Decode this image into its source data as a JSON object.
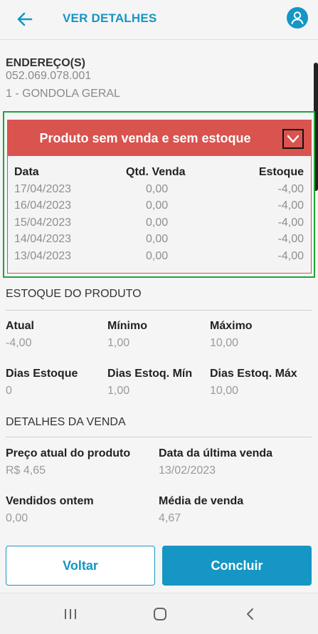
{
  "header": {
    "title": "VER DETALHES",
    "back_icon": "arrow-left-icon",
    "profile_icon": "user-avatar-icon"
  },
  "address": {
    "heading": "ENDEREÇO(S)",
    "code": "052.069.078.001",
    "location": "1 - GONDOLA GERAL"
  },
  "alert_card": {
    "title": "Produto sem venda e sem estoque",
    "toggle_icon": "chevron-down-icon",
    "color": "#d9534f",
    "columns": [
      "Data",
      "Qtd. Venda",
      "Estoque"
    ],
    "rows": [
      [
        "17/04/2023",
        "0,00",
        "-4,00"
      ],
      [
        "16/04/2023",
        "0,00",
        "-4,00"
      ],
      [
        "15/04/2023",
        "0,00",
        "-4,00"
      ],
      [
        "14/04/2023",
        "0,00",
        "-4,00"
      ],
      [
        "13/04/2023",
        "0,00",
        "-4,00"
      ]
    ]
  },
  "stock": {
    "heading": "ESTOQUE DO PRODUTO",
    "atual_label": "Atual",
    "atual_value": "-4,00",
    "minimo_label": "Mínimo",
    "minimo_value": "1,00",
    "maximo_label": "Máximo",
    "maximo_value": "10,00",
    "dias_label": "Dias Estoque",
    "dias_value": "0",
    "dias_min_label": "Dias Estoq. Mín",
    "dias_min_value": "1,00",
    "dias_max_label": "Dias Estoq. Máx",
    "dias_max_value": "10,00"
  },
  "sales": {
    "heading": "DETALHES DA VENDA",
    "price_label": "Preço atual do produto",
    "price_value": "R$ 4,65",
    "last_sale_label": "Data da última venda",
    "last_sale_value": "13/02/2023",
    "sold_yesterday_label": "Vendidos ontem",
    "sold_yesterday_value": "0,00",
    "avg_label": "Média de venda",
    "avg_value": "4,67"
  },
  "actions": {
    "back_label": "Voltar",
    "confirm_label": "Concluir"
  },
  "colors": {
    "accent": "#1596c4",
    "alert": "#d9534f",
    "focus": "#1fa33a"
  },
  "system_nav": {
    "recents_icon": "recents-icon",
    "home_icon": "home-icon",
    "back_icon": "back-chevron-icon"
  }
}
